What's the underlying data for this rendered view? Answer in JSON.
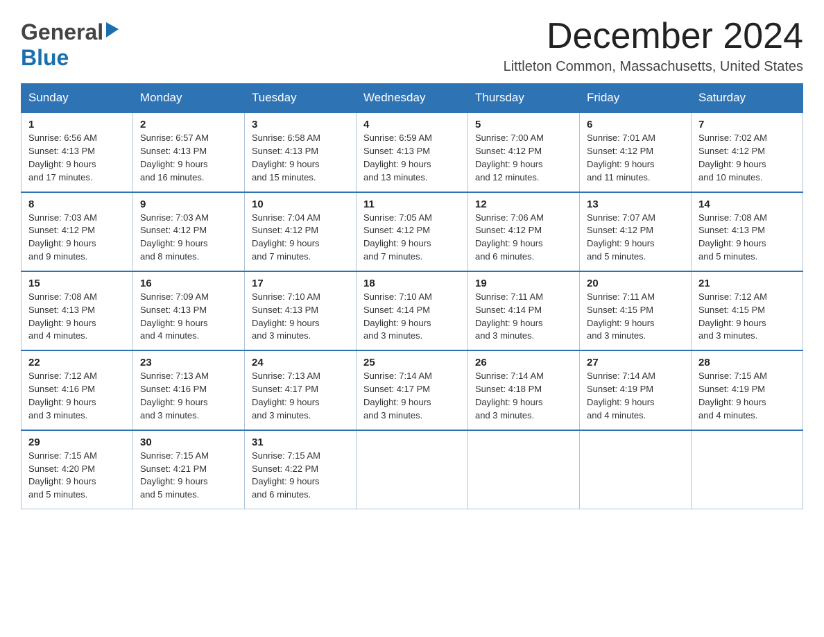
{
  "header": {
    "logo_general": "General",
    "logo_blue": "Blue",
    "month_title": "December 2024",
    "location": "Littleton Common, Massachusetts, United States"
  },
  "days_of_week": [
    "Sunday",
    "Monday",
    "Tuesday",
    "Wednesday",
    "Thursday",
    "Friday",
    "Saturday"
  ],
  "weeks": [
    [
      {
        "date": "1",
        "sunrise": "6:56 AM",
        "sunset": "4:13 PM",
        "daylight": "9 hours and 17 minutes."
      },
      {
        "date": "2",
        "sunrise": "6:57 AM",
        "sunset": "4:13 PM",
        "daylight": "9 hours and 16 minutes."
      },
      {
        "date": "3",
        "sunrise": "6:58 AM",
        "sunset": "4:13 PM",
        "daylight": "9 hours and 15 minutes."
      },
      {
        "date": "4",
        "sunrise": "6:59 AM",
        "sunset": "4:13 PM",
        "daylight": "9 hours and 13 minutes."
      },
      {
        "date": "5",
        "sunrise": "7:00 AM",
        "sunset": "4:12 PM",
        "daylight": "9 hours and 12 minutes."
      },
      {
        "date": "6",
        "sunrise": "7:01 AM",
        "sunset": "4:12 PM",
        "daylight": "9 hours and 11 minutes."
      },
      {
        "date": "7",
        "sunrise": "7:02 AM",
        "sunset": "4:12 PM",
        "daylight": "9 hours and 10 minutes."
      }
    ],
    [
      {
        "date": "8",
        "sunrise": "7:03 AM",
        "sunset": "4:12 PM",
        "daylight": "9 hours and 9 minutes."
      },
      {
        "date": "9",
        "sunrise": "7:03 AM",
        "sunset": "4:12 PM",
        "daylight": "9 hours and 8 minutes."
      },
      {
        "date": "10",
        "sunrise": "7:04 AM",
        "sunset": "4:12 PM",
        "daylight": "9 hours and 7 minutes."
      },
      {
        "date": "11",
        "sunrise": "7:05 AM",
        "sunset": "4:12 PM",
        "daylight": "9 hours and 7 minutes."
      },
      {
        "date": "12",
        "sunrise": "7:06 AM",
        "sunset": "4:12 PM",
        "daylight": "9 hours and 6 minutes."
      },
      {
        "date": "13",
        "sunrise": "7:07 AM",
        "sunset": "4:12 PM",
        "daylight": "9 hours and 5 minutes."
      },
      {
        "date": "14",
        "sunrise": "7:08 AM",
        "sunset": "4:13 PM",
        "daylight": "9 hours and 5 minutes."
      }
    ],
    [
      {
        "date": "15",
        "sunrise": "7:08 AM",
        "sunset": "4:13 PM",
        "daylight": "9 hours and 4 minutes."
      },
      {
        "date": "16",
        "sunrise": "7:09 AM",
        "sunset": "4:13 PM",
        "daylight": "9 hours and 4 minutes."
      },
      {
        "date": "17",
        "sunrise": "7:10 AM",
        "sunset": "4:13 PM",
        "daylight": "9 hours and 3 minutes."
      },
      {
        "date": "18",
        "sunrise": "7:10 AM",
        "sunset": "4:14 PM",
        "daylight": "9 hours and 3 minutes."
      },
      {
        "date": "19",
        "sunrise": "7:11 AM",
        "sunset": "4:14 PM",
        "daylight": "9 hours and 3 minutes."
      },
      {
        "date": "20",
        "sunrise": "7:11 AM",
        "sunset": "4:15 PM",
        "daylight": "9 hours and 3 minutes."
      },
      {
        "date": "21",
        "sunrise": "7:12 AM",
        "sunset": "4:15 PM",
        "daylight": "9 hours and 3 minutes."
      }
    ],
    [
      {
        "date": "22",
        "sunrise": "7:12 AM",
        "sunset": "4:16 PM",
        "daylight": "9 hours and 3 minutes."
      },
      {
        "date": "23",
        "sunrise": "7:13 AM",
        "sunset": "4:16 PM",
        "daylight": "9 hours and 3 minutes."
      },
      {
        "date": "24",
        "sunrise": "7:13 AM",
        "sunset": "4:17 PM",
        "daylight": "9 hours and 3 minutes."
      },
      {
        "date": "25",
        "sunrise": "7:14 AM",
        "sunset": "4:17 PM",
        "daylight": "9 hours and 3 minutes."
      },
      {
        "date": "26",
        "sunrise": "7:14 AM",
        "sunset": "4:18 PM",
        "daylight": "9 hours and 3 minutes."
      },
      {
        "date": "27",
        "sunrise": "7:14 AM",
        "sunset": "4:19 PM",
        "daylight": "9 hours and 4 minutes."
      },
      {
        "date": "28",
        "sunrise": "7:15 AM",
        "sunset": "4:19 PM",
        "daylight": "9 hours and 4 minutes."
      }
    ],
    [
      {
        "date": "29",
        "sunrise": "7:15 AM",
        "sunset": "4:20 PM",
        "daylight": "9 hours and 5 minutes."
      },
      {
        "date": "30",
        "sunrise": "7:15 AM",
        "sunset": "4:21 PM",
        "daylight": "9 hours and 5 minutes."
      },
      {
        "date": "31",
        "sunrise": "7:15 AM",
        "sunset": "4:22 PM",
        "daylight": "9 hours and 6 minutes."
      },
      null,
      null,
      null,
      null
    ]
  ],
  "labels": {
    "sunrise": "Sunrise:",
    "sunset": "Sunset:",
    "daylight": "Daylight:"
  }
}
